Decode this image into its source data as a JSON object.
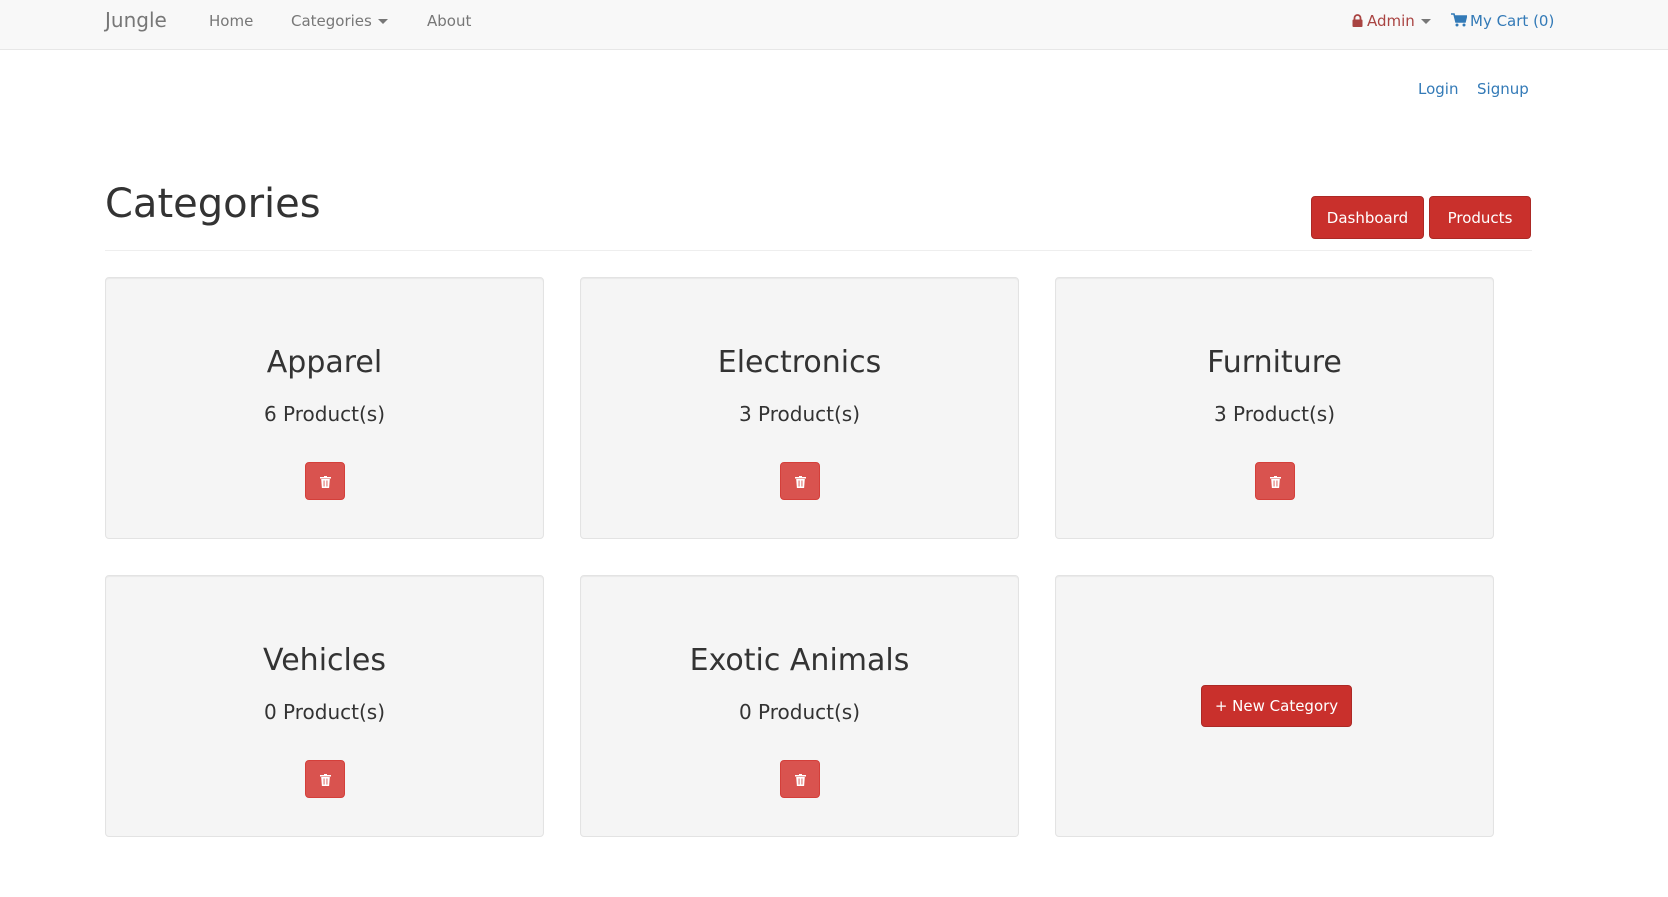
{
  "nav": {
    "brand": "Jungle",
    "home": "Home",
    "categories": "Categories",
    "about": "About",
    "admin": "Admin",
    "cart": "My Cart (0)"
  },
  "auth": {
    "login": "Login",
    "signup": "Signup"
  },
  "page": {
    "title": "Categories",
    "dashboard_button": "Dashboard",
    "products_button": "Products"
  },
  "categories": [
    {
      "name": "Apparel",
      "count": "6 Product(s)"
    },
    {
      "name": "Electronics",
      "count": "3 Product(s)"
    },
    {
      "name": "Furniture",
      "count": "3 Product(s)"
    },
    {
      "name": "Vehicles",
      "count": "0 Product(s)"
    },
    {
      "name": "Exotic Animals",
      "count": "0 Product(s)"
    }
  ],
  "new_category_button": "+ New Category",
  "icons": {
    "admin": "lock-icon",
    "cart": "shopping-cart-icon",
    "delete": "trash-icon"
  },
  "colors": {
    "navbar_bg": "#f8f8f8",
    "primary_red": "#c9302c",
    "delete_red": "#d9534f",
    "link_blue": "#337ab7",
    "admin_red": "#a94442",
    "card_bg": "#f5f5f5"
  }
}
